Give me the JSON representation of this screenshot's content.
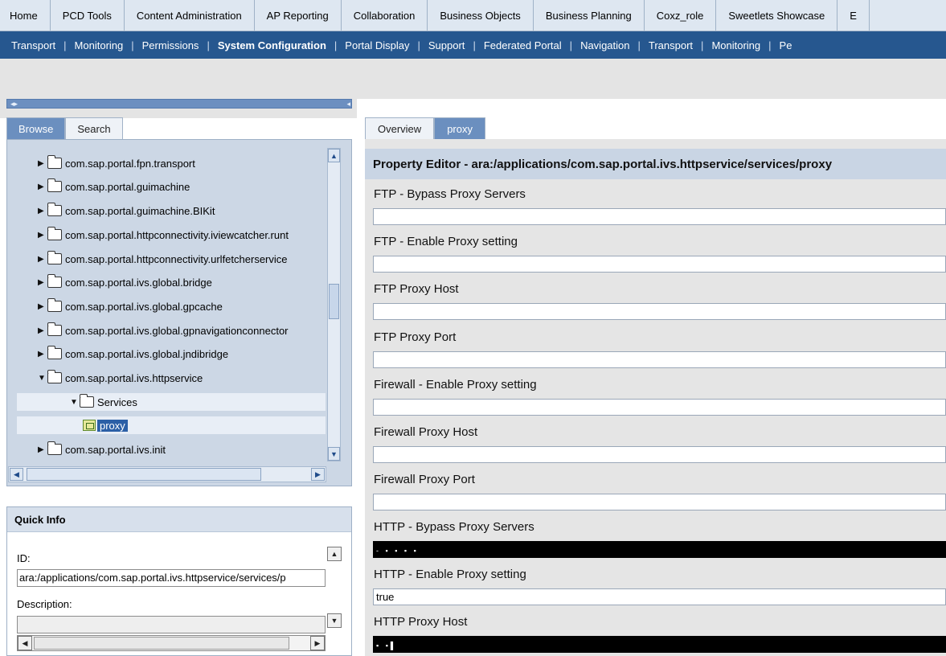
{
  "top_nav": [
    {
      "label": "Home"
    },
    {
      "label": "PCD Tools"
    },
    {
      "label": "Content Administration"
    },
    {
      "label": "AP Reporting"
    },
    {
      "label": "Collaboration"
    },
    {
      "label": "Business Objects"
    },
    {
      "label": "Business Planning"
    },
    {
      "label": "Coxz_role"
    },
    {
      "label": "Sweetlets Showcase"
    },
    {
      "label": "E"
    }
  ],
  "sub_nav": [
    {
      "label": "Transport"
    },
    {
      "label": "Monitoring"
    },
    {
      "label": "Permissions"
    },
    {
      "label": "System Configuration",
      "active": true
    },
    {
      "label": "Portal Display"
    },
    {
      "label": "Support"
    },
    {
      "label": "Federated Portal"
    },
    {
      "label": "Navigation"
    },
    {
      "label": "Transport"
    },
    {
      "label": "Monitoring"
    },
    {
      "label": "Pe"
    }
  ],
  "left_tabs": {
    "browse": "Browse",
    "search": "Search"
  },
  "tree": {
    "items": [
      {
        "label": "com.sap.portal.fpn.transport"
      },
      {
        "label": "com.sap.portal.guimachine"
      },
      {
        "label": "com.sap.portal.guimachine.BIKit"
      },
      {
        "label": "com.sap.portal.httpconnectivity.iviewcatcher.runt"
      },
      {
        "label": "com.sap.portal.httpconnectivity.urlfetcherservice"
      },
      {
        "label": "com.sap.portal.ivs.global.bridge"
      },
      {
        "label": "com.sap.portal.ivs.global.gpcache"
      },
      {
        "label": "com.sap.portal.ivs.global.gpnavigationconnector"
      },
      {
        "label": "com.sap.portal.ivs.global.jndibridge"
      },
      {
        "label": "com.sap.portal.ivs.httpservice"
      },
      {
        "label": "Services"
      },
      {
        "label": "proxy"
      },
      {
        "label": "com.sap.portal.ivs.init"
      }
    ]
  },
  "quick_info": {
    "title": "Quick Info",
    "id_label": "ID:",
    "id_value": "ara:/applications/com.sap.portal.ivs.httpservice/services/p",
    "description_label": "Description:",
    "description_value": ""
  },
  "right_tabs": {
    "overview": "Overview",
    "proxy": "proxy"
  },
  "property_editor": {
    "title": "Property Editor - ara:/applications/com.sap.portal.ivs.httpservice/services/proxy",
    "properties": [
      {
        "label": "FTP - Bypass Proxy Servers",
        "value": ""
      },
      {
        "label": "FTP - Enable Proxy setting",
        "value": ""
      },
      {
        "label": "FTP Proxy Host",
        "value": ""
      },
      {
        "label": "FTP Proxy Port",
        "value": ""
      },
      {
        "label": "Firewall - Enable Proxy setting",
        "value": ""
      },
      {
        "label": "Firewall Proxy Host",
        "value": ""
      },
      {
        "label": "Firewall Proxy Port",
        "value": ""
      },
      {
        "label": "HTTP - Bypass Proxy Servers",
        "value": "- ▪ ▪ ▪ ▪",
        "masked": true
      },
      {
        "label": "HTTP - Enable Proxy setting",
        "value": "true"
      },
      {
        "label": "HTTP Proxy Host",
        "value": "▪ ▪▌",
        "masked": true
      }
    ]
  }
}
